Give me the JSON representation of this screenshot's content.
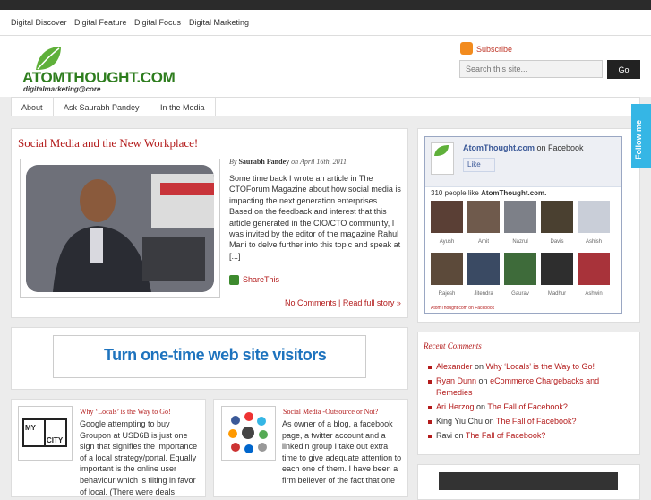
{
  "top_nav": [
    "Digital Discover",
    "Digital Feature",
    "Digital Focus",
    "Digital Marketing"
  ],
  "logo": {
    "text": "ATOMTHOUGHT.COM",
    "tagline": "digitalmarketing@core"
  },
  "subscribe_label": "Subscribe",
  "search": {
    "placeholder": "Search this site...",
    "go_label": "Go"
  },
  "main_nav": [
    "About",
    "Ask Saurabh Pandey",
    "In the Media"
  ],
  "featured_post": {
    "title": "Social Media and the New Workplace!",
    "byline_prefix": "By",
    "author": "Saurabh Pandey",
    "byline_on": "on",
    "date": "April 16th, 2011",
    "excerpt": "Some time back I wrote an article in The CTOForum Magazine about how social media is impacting the next generation enterprises. Based on the feedback and interest that this article generated in the CIO/CTO community, I was invited by the editor of the magazine Rahul Mani to delve further into this topic and speak at [...]",
    "share_label": "ShareThis",
    "comments_label": "No Comments",
    "readmore_label": "Read full story »"
  },
  "banner_text": "Turn one-time web site visitors",
  "post_small_1": {
    "title": "Why ‘Locals’ is the Way to Go!",
    "thumb_text": "MY CITY",
    "text": "Google attempting to buy Groupon at USD6B is just one sign that signifies the importance of a local strategy/portal. Equally important is the online user behaviour which is tilting in favor of local. (There were deals"
  },
  "post_small_2": {
    "title": "Social Media -Outsource or Not?",
    "text": "As owner of a blog, a facebook page, a twitter account and a linkedin group I take out extra time to give adequate attention to each one of them. I have been a firm believer of the fact that one"
  },
  "facebook": {
    "page_name": "AtomThought.com",
    "on_facebook": "on Facebook",
    "like_label": "Like",
    "count_text": "310 people like",
    "count_page": "AtomThought.com.",
    "fans": [
      "Ayush",
      "Amit",
      "Nazrul",
      "Davis",
      "Ashish",
      "Rajesh",
      "Jitendra",
      "Gaurav",
      "Madhur",
      "Ashwin"
    ],
    "footer": "AtomThought.com on Facebook"
  },
  "recent_comments": {
    "title": "Recent Comments",
    "items": [
      {
        "author": "Alexander",
        "on": "on",
        "post": "Why ‘Locals’ is the Way to Go!"
      },
      {
        "author": "Ryan Dunn",
        "on": "on",
        "post": "eCommerce Chargebacks and Remedies"
      },
      {
        "author": "Ari Herzog",
        "on": "on",
        "post": "The Fall of Facebook?"
      },
      {
        "author": "King Yiu Chu",
        "on": "on",
        "post": "The Fall of Facebook?"
      },
      {
        "author": "Ravi",
        "on": "on",
        "post": "The Fall of Facebook?"
      }
    ]
  },
  "follow_label": "Follow me",
  "colors": {
    "accent": "#b31b1b",
    "brand_green": "#2e7d1e",
    "facebook_blue": "#3b5998",
    "follow_blue": "#35b6e5"
  }
}
